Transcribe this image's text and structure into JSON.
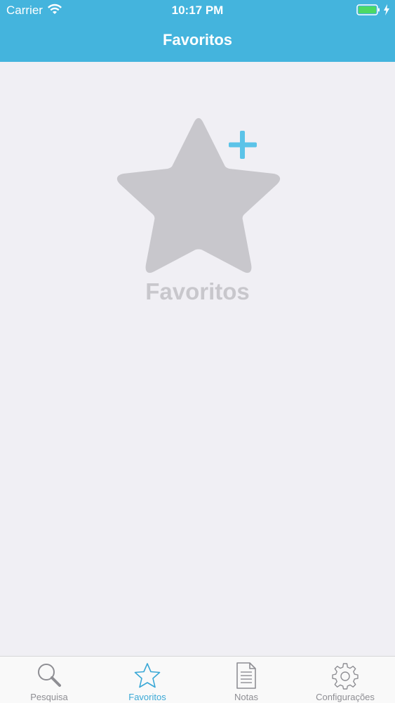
{
  "status_bar": {
    "carrier": "Carrier",
    "time": "10:17 PM",
    "battery_icon": "battery-charging-icon",
    "wifi_icon": "wifi-icon"
  },
  "nav": {
    "title": "Favoritos"
  },
  "empty_state": {
    "icon": "star-add-icon",
    "label": "Favoritos"
  },
  "tab_bar": {
    "items": [
      {
        "label": "Pesquisa",
        "icon": "search-icon",
        "active": false
      },
      {
        "label": "Favoritos",
        "icon": "star-icon",
        "active": true
      },
      {
        "label": "Notas",
        "icon": "document-icon",
        "active": false
      },
      {
        "label": "Configurações",
        "icon": "gear-icon",
        "active": false
      }
    ]
  },
  "colors": {
    "accent": "#44b4dd",
    "background": "#f0eff4",
    "placeholder_gray": "#c8c7cc",
    "tab_inactive": "#8e8e93",
    "tab_active": "#3aa8d6"
  }
}
